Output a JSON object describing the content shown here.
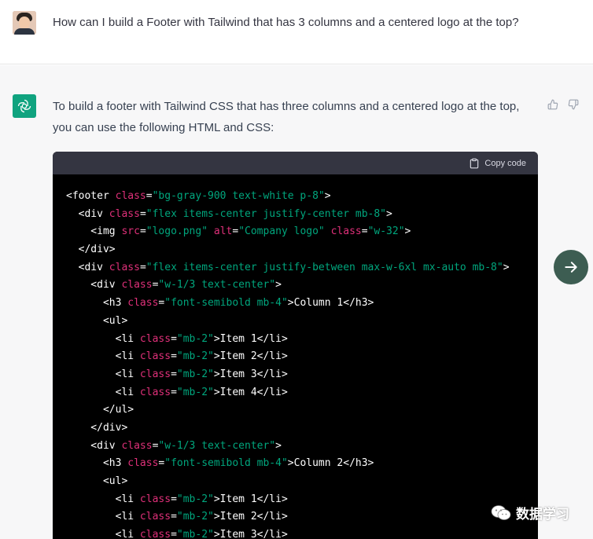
{
  "user": {
    "avatar": "user-avatar-photo",
    "message": "How can I build a Footer with Tailwind that has 3 columns and a centered logo at the top?"
  },
  "assistant": {
    "icon": "openai-logo-icon",
    "intro_line1": "To build a footer with Tailwind CSS that has three columns and a centered logo at the top,",
    "intro_line2": "you can use the following HTML and CSS:",
    "feedback": [
      "thumbs-up-icon",
      "thumbs-down-icon"
    ]
  },
  "code_block": {
    "copy_label": "Copy code",
    "lines": [
      [
        [
          "t",
          "<footer "
        ],
        [
          "a",
          "class"
        ],
        [
          "t",
          "="
        ],
        [
          "s",
          "\"bg-gray-900 text-white p-8\""
        ],
        [
          "t",
          ">"
        ]
      ],
      [
        [
          "t",
          "  <div "
        ],
        [
          "a",
          "class"
        ],
        [
          "t",
          "="
        ],
        [
          "s",
          "\"flex items-center justify-center mb-8\""
        ],
        [
          "t",
          ">"
        ]
      ],
      [
        [
          "t",
          "    <img "
        ],
        [
          "a",
          "src"
        ],
        [
          "t",
          "="
        ],
        [
          "s",
          "\"logo.png\""
        ],
        [
          "t",
          " "
        ],
        [
          "a",
          "alt"
        ],
        [
          "t",
          "="
        ],
        [
          "s",
          "\"Company logo\""
        ],
        [
          "t",
          " "
        ],
        [
          "a",
          "class"
        ],
        [
          "t",
          "="
        ],
        [
          "s",
          "\"w-32\""
        ],
        [
          "t",
          ">"
        ]
      ],
      [
        [
          "t",
          "  </div>"
        ]
      ],
      [
        [
          "t",
          "  <div "
        ],
        [
          "a",
          "class"
        ],
        [
          "t",
          "="
        ],
        [
          "s",
          "\"flex items-center justify-between max-w-6xl mx-auto mb-8\""
        ],
        [
          "t",
          ">"
        ]
      ],
      [
        [
          "t",
          "    <div "
        ],
        [
          "a",
          "class"
        ],
        [
          "t",
          "="
        ],
        [
          "s",
          "\"w-1/3 text-center\""
        ],
        [
          "t",
          ">"
        ]
      ],
      [
        [
          "t",
          "      <h3 "
        ],
        [
          "a",
          "class"
        ],
        [
          "t",
          "="
        ],
        [
          "s",
          "\"font-semibold mb-4\""
        ],
        [
          "t",
          ">Column 1</h3>"
        ]
      ],
      [
        [
          "t",
          "      <ul>"
        ]
      ],
      [
        [
          "t",
          "        <li "
        ],
        [
          "a",
          "class"
        ],
        [
          "t",
          "="
        ],
        [
          "s",
          "\"mb-2\""
        ],
        [
          "t",
          ">Item 1</li>"
        ]
      ],
      [
        [
          "t",
          "        <li "
        ],
        [
          "a",
          "class"
        ],
        [
          "t",
          "="
        ],
        [
          "s",
          "\"mb-2\""
        ],
        [
          "t",
          ">Item 2</li>"
        ]
      ],
      [
        [
          "t",
          "        <li "
        ],
        [
          "a",
          "class"
        ],
        [
          "t",
          "="
        ],
        [
          "s",
          "\"mb-2\""
        ],
        [
          "t",
          ">Item 3</li>"
        ]
      ],
      [
        [
          "t",
          "        <li "
        ],
        [
          "a",
          "class"
        ],
        [
          "t",
          "="
        ],
        [
          "s",
          "\"mb-2\""
        ],
        [
          "t",
          ">Item 4</li>"
        ]
      ],
      [
        [
          "t",
          "      </ul>"
        ]
      ],
      [
        [
          "t",
          "    </div>"
        ]
      ],
      [
        [
          "t",
          "    <div "
        ],
        [
          "a",
          "class"
        ],
        [
          "t",
          "="
        ],
        [
          "s",
          "\"w-1/3 text-center\""
        ],
        [
          "t",
          ">"
        ]
      ],
      [
        [
          "t",
          "      <h3 "
        ],
        [
          "a",
          "class"
        ],
        [
          "t",
          "="
        ],
        [
          "s",
          "\"font-semibold mb-4\""
        ],
        [
          "t",
          ">Column 2</h3>"
        ]
      ],
      [
        [
          "t",
          "      <ul>"
        ]
      ],
      [
        [
          "t",
          "        <li "
        ],
        [
          "a",
          "class"
        ],
        [
          "t",
          "="
        ],
        [
          "s",
          "\"mb-2\""
        ],
        [
          "t",
          ">Item 1</li>"
        ]
      ],
      [
        [
          "t",
          "        <li "
        ],
        [
          "a",
          "class"
        ],
        [
          "t",
          "="
        ],
        [
          "s",
          "\"mb-2\""
        ],
        [
          "t",
          ">Item 2</li>"
        ]
      ],
      [
        [
          "t",
          "        <li "
        ],
        [
          "a",
          "class"
        ],
        [
          "t",
          "="
        ],
        [
          "s",
          "\"mb-2\""
        ],
        [
          "t",
          ">Item 3</li>"
        ]
      ]
    ]
  },
  "next_button": {
    "icon": "arrow-right-icon"
  },
  "watermark": {
    "text": "数据学习",
    "icon": "wechat-icon"
  },
  "colors": {
    "code_bg": "#000000",
    "code_header": "#343541",
    "tag": "#ffffff",
    "attr": "#df3079",
    "string": "#00a67d",
    "accent": "#10a37f",
    "next_button": "#3d5d52"
  }
}
